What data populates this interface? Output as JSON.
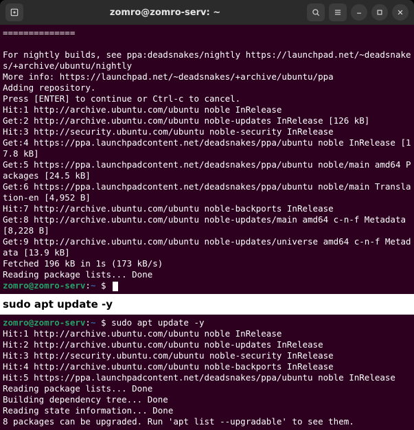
{
  "titlebar": {
    "title": "zomro@zomro-serv: ~",
    "new_tab_icon": "new-tab-icon",
    "search_icon": "search-icon",
    "menu_icon": "hamburger-icon",
    "minimize_icon": "minimize-icon",
    "maximize_icon": "maximize-icon",
    "close_icon": "close-icon"
  },
  "term1": {
    "divider": "==============",
    "lines": [
      "For nightly builds, see ppa:deadsnakes/nightly https://launchpad.net/~deadsnakes/+archive/ubuntu/nightly",
      "More info: https://launchpad.net/~deadsnakes/+archive/ubuntu/ppa",
      "Adding repository.",
      "Press [ENTER] to continue or Ctrl-c to cancel.",
      "Hit:1 http://archive.ubuntu.com/ubuntu noble InRelease",
      "Get:2 http://archive.ubuntu.com/ubuntu noble-updates InRelease [126 kB]",
      "Hit:3 http://security.ubuntu.com/ubuntu noble-security InRelease",
      "Get:4 https://ppa.launchpadcontent.net/deadsnakes/ppa/ubuntu noble InRelease [17.8 kB]",
      "Get:5 https://ppa.launchpadcontent.net/deadsnakes/ppa/ubuntu noble/main amd64 Packages [24.5 kB]",
      "Get:6 https://ppa.launchpadcontent.net/deadsnakes/ppa/ubuntu noble/main Translation-en [4,952 B]",
      "Hit:7 http://archive.ubuntu.com/ubuntu noble-backports InRelease",
      "Get:8 http://archive.ubuntu.com/ubuntu noble-updates/main amd64 c-n-f Metadata [8,228 B]",
      "Get:9 http://archive.ubuntu.com/ubuntu noble-updates/universe amd64 c-n-f Metadata [13.9 kB]",
      "Fetched 196 kB in 1s (173 kB/s)",
      "Reading package lists... Done"
    ],
    "prompt_user": "zomro@zomro-serv",
    "prompt_path": "~",
    "prompt_sep": ":",
    "prompt_symbol": "$"
  },
  "instruction": {
    "text": "sudo apt update -y"
  },
  "term2": {
    "prompt_user": "zomro@zomro-serv",
    "prompt_path": "~",
    "prompt_sep": ":",
    "prompt_symbol": "$",
    "command": "sudo apt update -y",
    "lines": [
      "Hit:1 http://archive.ubuntu.com/ubuntu noble InRelease",
      "Hit:2 http://archive.ubuntu.com/ubuntu noble-updates InRelease",
      "Hit:3 http://security.ubuntu.com/ubuntu noble-security InRelease",
      "Hit:4 http://archive.ubuntu.com/ubuntu noble-backports InRelease",
      "Hit:5 https://ppa.launchpadcontent.net/deadsnakes/ppa/ubuntu noble InRelease",
      "Reading package lists... Done",
      "Building dependency tree... Done",
      "Reading state information... Done",
      "8 packages can be upgraded. Run 'apt list --upgradable' to see them."
    ]
  }
}
